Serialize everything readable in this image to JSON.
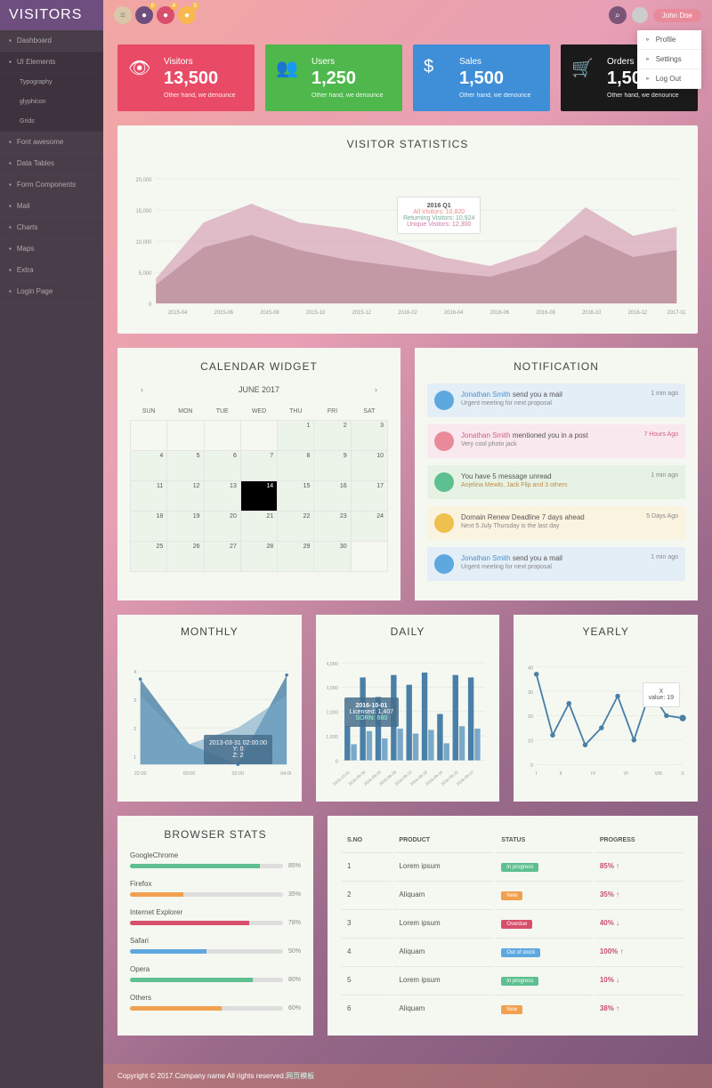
{
  "brand": "VISITORS",
  "nav": [
    {
      "icon": "dashboard",
      "label": "Dashboard"
    },
    {
      "icon": "ui",
      "label": "UI Elements",
      "active": true,
      "children": [
        "Typography",
        "glyphicon",
        "Grids"
      ]
    },
    {
      "icon": "font",
      "label": "Font awesome"
    },
    {
      "icon": "table",
      "label": "Data Tables"
    },
    {
      "icon": "form",
      "label": "Form Components"
    },
    {
      "icon": "mail",
      "label": "Mail"
    },
    {
      "icon": "chart",
      "label": "Charts"
    },
    {
      "icon": "map",
      "label": "Maps"
    },
    {
      "icon": "extra",
      "label": "Extra"
    },
    {
      "icon": "login",
      "label": "Login Page"
    }
  ],
  "topbar": {
    "icons": [
      {
        "name": "menu-icon",
        "color": "#6e4e7e",
        "badge": "8"
      },
      {
        "name": "mail-icon",
        "color": "#d84f6b",
        "badge": "4"
      },
      {
        "name": "bell-icon",
        "color": "#f8b84e",
        "badge": "5"
      }
    ],
    "search_icon": "search",
    "user": "John Doe",
    "dropdown": [
      "Profile",
      "Settings",
      "Log Out"
    ]
  },
  "stat_cards": [
    {
      "title": "Visitors",
      "value": "13,500",
      "sub": "Other hand, we denounce",
      "color": "#e94b67",
      "icon": "eye"
    },
    {
      "title": "Users",
      "value": "1,250",
      "sub": "Other hand, we denounce",
      "color": "#4fb84c",
      "icon": "users"
    },
    {
      "title": "Sales",
      "value": "1,500",
      "sub": "Other hand, we denounce",
      "color": "#3e8fd8",
      "icon": "dollar"
    },
    {
      "title": "Orders",
      "value": "1,500",
      "sub": "Other hand, we denounce",
      "color": "#1a1a1a",
      "icon": "cart"
    }
  ],
  "main_chart": {
    "title": "VISITOR STATISTICS",
    "tooltip": {
      "period": "2016 Q1",
      "lines": [
        {
          "label": "All Visitors:",
          "val": "10,820",
          "color": "#e88"
        },
        {
          "label": "Returning Visitors:",
          "val": "10,924",
          "color": "#7a9"
        },
        {
          "label": "Unique Visitors:",
          "val": "12,300",
          "color": "#c7a"
        }
      ]
    }
  },
  "chart_data": {
    "main": {
      "type": "area",
      "xlabel": "",
      "ylabel": "",
      "ylim": [
        0,
        20000
      ],
      "categories": [
        "2015-04",
        "2015-06",
        "2015-08",
        "2015-10",
        "2015-12",
        "2016-02",
        "2016-04",
        "2016-06",
        "2016-08",
        "2016-10",
        "2016-12",
        "2017-02"
      ],
      "series": [
        {
          "name": "All Visitors",
          "values": [
            4000,
            13000,
            16000,
            13000,
            12000,
            10000,
            7500,
            6000,
            8500,
            15500,
            11000,
            12500
          ]
        },
        {
          "name": "Returning Visitors",
          "values": [
            3000,
            9000,
            11000,
            8500,
            7000,
            6000,
            5000,
            4500,
            6500,
            11000,
            7500,
            8500
          ]
        }
      ]
    },
    "monthly": {
      "type": "area",
      "categories": [
        "22:00",
        "00:00",
        "02:00",
        "04:00"
      ],
      "series": [
        {
          "name": "Y",
          "values": [
            4,
            1,
            0,
            4
          ]
        },
        {
          "name": "Z",
          "values": [
            3,
            1,
            2,
            3
          ]
        }
      ],
      "tooltip": {
        "label": "2013-03-31 02:00:00",
        "y": "0",
        "z": "2"
      }
    },
    "daily": {
      "type": "bar",
      "categories": [
        "2016-10-01",
        "2016-09-30",
        "2016-09-29",
        "2016-09-28",
        "2016-09-19",
        "2016-09-18",
        "2016-09-16",
        "2016-09-15",
        "2016-09-10"
      ],
      "series": [
        {
          "name": "Licensed",
          "values": [
            1407,
            3400,
            2600,
            3500,
            3100,
            3600,
            1900,
            3500,
            3400
          ]
        },
        {
          "name": "SORN",
          "values": [
            660,
            1200,
            900,
            1300,
            1100,
            1250,
            700,
            1400,
            1300
          ]
        }
      ],
      "ylim": [
        0,
        4000
      ],
      "tooltip": {
        "label": "2016-10-01",
        "licensed": "1,407",
        "sorn": "660"
      }
    },
    "yearly": {
      "type": "line",
      "categories": [
        "I",
        "II",
        "IV",
        "VI",
        "VIII",
        "X"
      ],
      "values": [
        37,
        12,
        25,
        8,
        15,
        28,
        10,
        30,
        20,
        19
      ],
      "ylim": [
        0,
        40
      ],
      "tooltip": {
        "label": "X",
        "value": "19"
      }
    }
  },
  "calendar": {
    "title": "CALENDAR WIDGET",
    "month": "JUNE 2017",
    "days": [
      "SUN",
      "MON",
      "TUE",
      "WED",
      "THU",
      "FRI",
      "SAT"
    ],
    "weeks": [
      [
        {
          "n": "",
          "dim": true
        },
        {
          "n": "",
          "dim": true
        },
        {
          "n": "",
          "dim": true
        },
        {
          "n": "",
          "dim": true
        },
        {
          "n": "1"
        },
        {
          "n": "2"
        },
        {
          "n": "3"
        }
      ],
      [
        {
          "n": "4"
        },
        {
          "n": "5"
        },
        {
          "n": "6"
        },
        {
          "n": "7"
        },
        {
          "n": "8"
        },
        {
          "n": "9"
        },
        {
          "n": "10"
        }
      ],
      [
        {
          "n": "11"
        },
        {
          "n": "12"
        },
        {
          "n": "13"
        },
        {
          "n": "14",
          "today": true
        },
        {
          "n": "15"
        },
        {
          "n": "16"
        },
        {
          "n": "17"
        }
      ],
      [
        {
          "n": "18"
        },
        {
          "n": "19"
        },
        {
          "n": "20"
        },
        {
          "n": "21"
        },
        {
          "n": "22"
        },
        {
          "n": "23"
        },
        {
          "n": "24"
        }
      ],
      [
        {
          "n": "25"
        },
        {
          "n": "26"
        },
        {
          "n": "27"
        },
        {
          "n": "28"
        },
        {
          "n": "29"
        },
        {
          "n": "30"
        },
        {
          "n": "",
          "dim": true
        }
      ]
    ]
  },
  "notifications": {
    "title": "NOTIFICATION",
    "items": [
      {
        "bg": "#e3eef7",
        "ico": "#5ea8e0",
        "who": "Jonathan Smith",
        "whoColor": "#4a8fd0",
        "text": " send you a mail",
        "sub": "Urgent meeting for next proposal",
        "time": "1 min ago",
        "timeColor": "#888"
      },
      {
        "bg": "#f9e8ed",
        "ico": "#e88a9a",
        "who": "Jonathan Smith",
        "whoColor": "#d0608a",
        "text": " mentioned you in a post",
        "sub": "Very cool photo jack",
        "time": "7 Hours Ago",
        "timeColor": "#d0608a"
      },
      {
        "bg": "#e6f3e4",
        "ico": "#5ec090",
        "who": "",
        "whoColor": "",
        "text": "You have 5 message unread",
        "sub": "Anjelina Mewlo, Jack Flip and 3 others",
        "subColor": "#c08a4a",
        "time": "1 min ago",
        "timeColor": "#888"
      },
      {
        "bg": "#faf3df",
        "ico": "#f0c04e",
        "who": "",
        "whoColor": "",
        "text": "Domain Renew Deadline 7 days ahead",
        "sub": "Next 5 July Thursday is the last day",
        "time": "5 Days Ago",
        "timeColor": "#888"
      },
      {
        "bg": "#e3eef7",
        "ico": "#5ea8e0",
        "who": "Jonathan Smith",
        "whoColor": "#4a8fd0",
        "text": " send you a mail",
        "sub": "Urgent meeting for next proposal",
        "time": "1 min ago",
        "timeColor": "#888"
      }
    ]
  },
  "small_titles": {
    "monthly": "MONTHLY",
    "daily": "DAILY",
    "yearly": "YEARLY"
  },
  "browser": {
    "title": "BROWSER STATS",
    "rows": [
      {
        "name": "GoogleChrome",
        "pct": 85,
        "color": "#5ec090"
      },
      {
        "name": "Firefox",
        "pct": 35,
        "color": "#f0a04e"
      },
      {
        "name": "Internet Explorer",
        "pct": 78,
        "color": "#d84f6b"
      },
      {
        "name": "Safari",
        "pct": 50,
        "color": "#5ea8e0"
      },
      {
        "name": "Opera",
        "pct": 80,
        "color": "#5ec090"
      },
      {
        "name": "Others",
        "pct": 60,
        "color": "#f0a04e"
      }
    ]
  },
  "products": {
    "headers": [
      "S.NO",
      "PRODUCT",
      "STATUS",
      "PROGRESS"
    ],
    "rows": [
      {
        "no": "1",
        "prod": "Lorem ipsum",
        "status": "In progress",
        "scolor": "#5ec090",
        "prog": "85%",
        "arrow": "↑"
      },
      {
        "no": "2",
        "prod": "Aliquam",
        "status": "New",
        "scolor": "#f0a04e",
        "prog": "35%",
        "arrow": "↑"
      },
      {
        "no": "3",
        "prod": "Lorem ipsum",
        "status": "Overdue",
        "scolor": "#d84f6b",
        "prog": "40%",
        "arrow": "↓"
      },
      {
        "no": "4",
        "prod": "Aliquam",
        "status": "Out of stock",
        "scolor": "#5ea8e0",
        "prog": "100%",
        "arrow": "↑"
      },
      {
        "no": "5",
        "prod": "Lorem ipsum",
        "status": "In progress",
        "scolor": "#5ec090",
        "prog": "10%",
        "arrow": "↓"
      },
      {
        "no": "6",
        "prod": "Aliquam",
        "status": "New",
        "scolor": "#f0a04e",
        "prog": "38%",
        "arrow": "↑"
      }
    ]
  },
  "footer": {
    "text": "Copyright © 2017.Company name All rights reserved.",
    "link": "网页模板"
  }
}
